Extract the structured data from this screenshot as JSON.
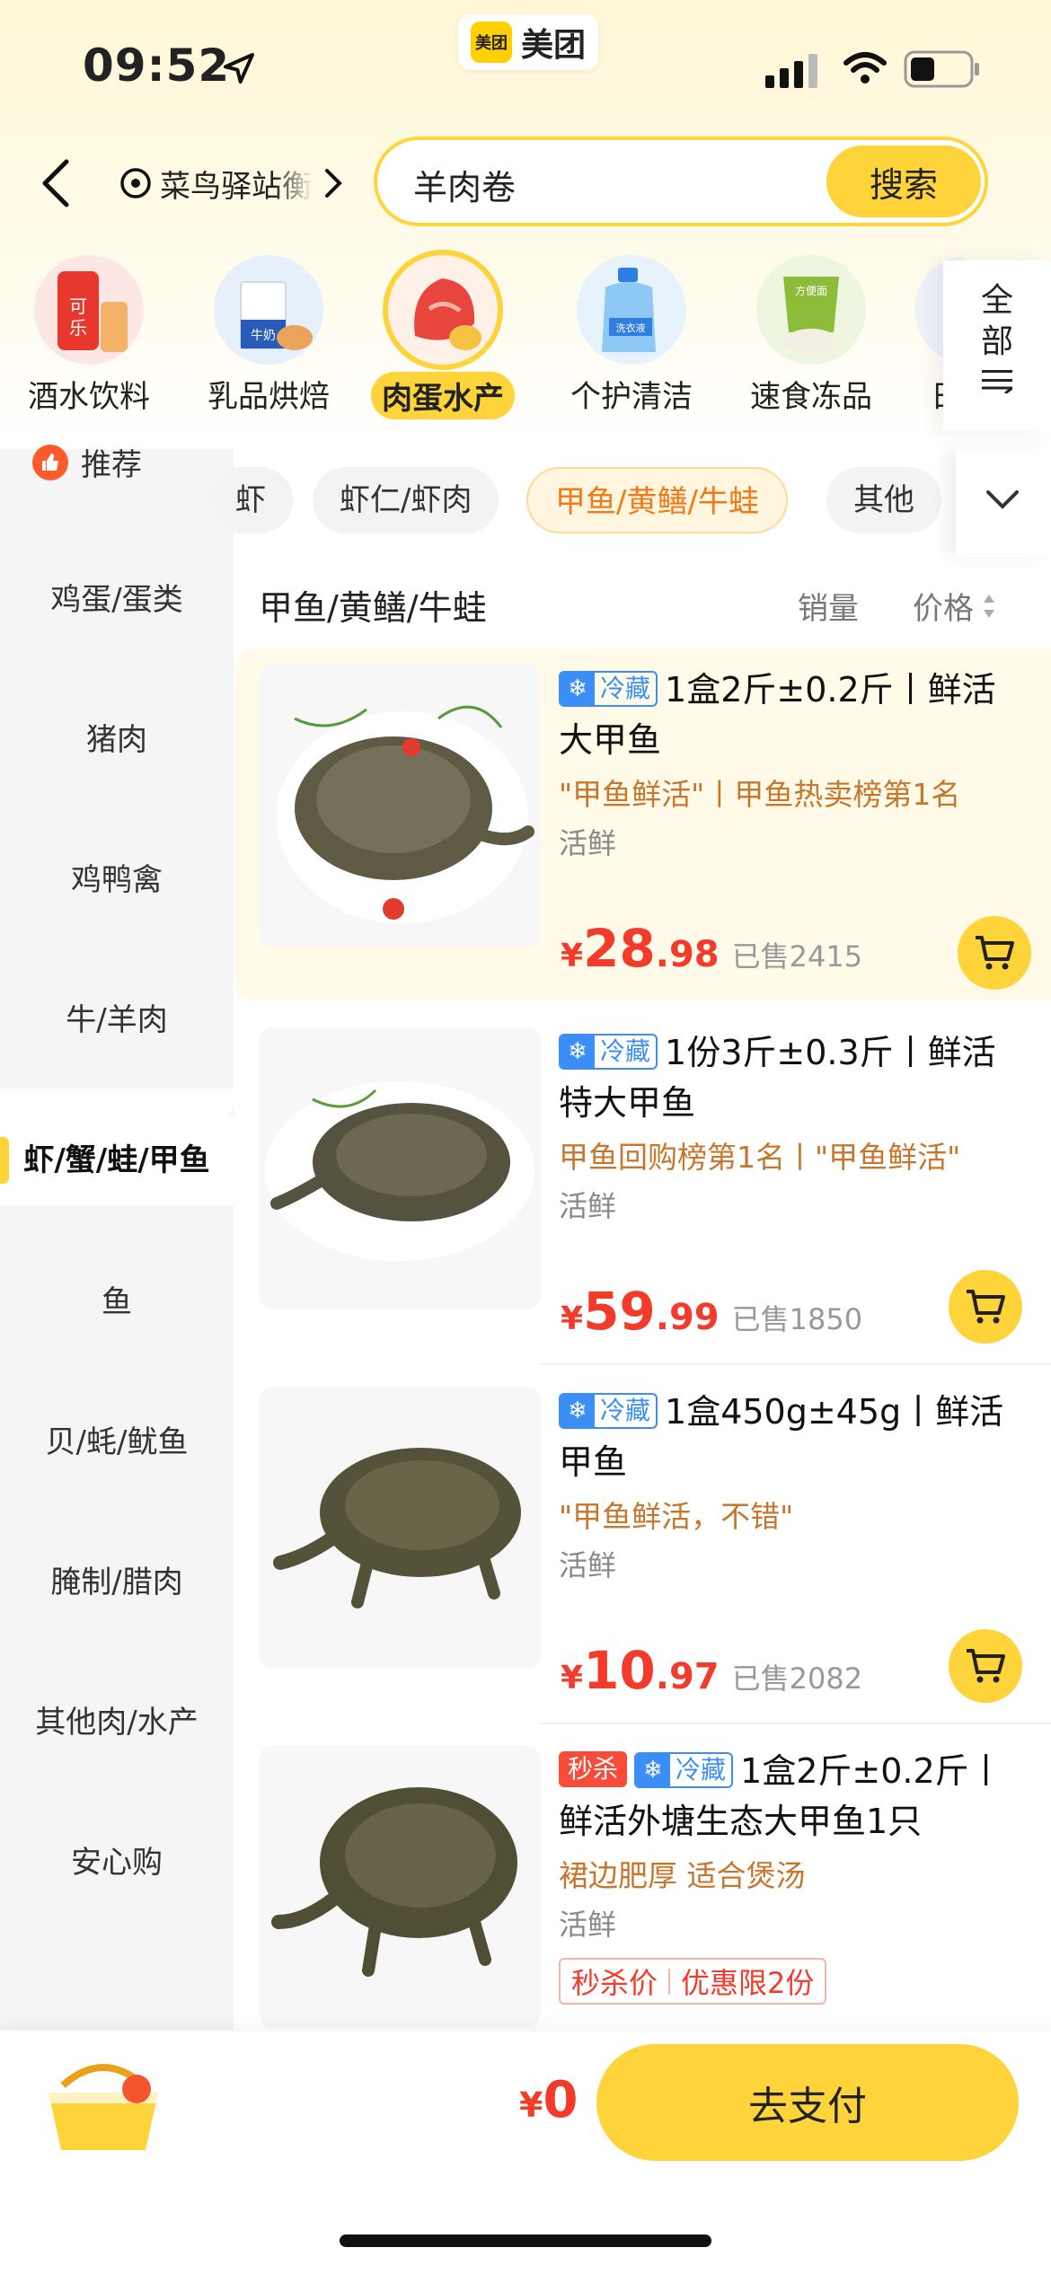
{
  "status_bar": {
    "time": "09:52",
    "app_name": "美团",
    "app_logo_text": "美团"
  },
  "header": {
    "location": "菜鸟驿站衡",
    "search_value": "羊肉卷",
    "search_button": "搜索"
  },
  "categories": [
    {
      "label": "酒水饮料",
      "icon": "drinks-icon"
    },
    {
      "label": "乳品烘焙",
      "icon": "dairy-icon"
    },
    {
      "label": "肉蛋水产",
      "icon": "meat-icon",
      "active": true
    },
    {
      "label": "个护清洁",
      "icon": "detergent-icon"
    },
    {
      "label": "速食冻品",
      "icon": "frozen-food-icon"
    },
    {
      "label": "日",
      "icon": "daily-icon"
    }
  ],
  "category_all": "全部",
  "sidebar": {
    "recommend": "推荐",
    "items": [
      {
        "label": "鸡蛋/蛋类"
      },
      {
        "label": "猪肉"
      },
      {
        "label": "鸡鸭禽"
      },
      {
        "label": "牛/羊肉"
      },
      {
        "label": "虾/蟹/蛙/甲鱼",
        "active": true
      },
      {
        "label": "鱼"
      },
      {
        "label": "贝/蚝/鱿鱼"
      },
      {
        "label": "腌制/腊肉"
      },
      {
        "label": "其他肉/水产"
      },
      {
        "label": "安心购"
      }
    ]
  },
  "subtags": [
    {
      "label": "虾"
    },
    {
      "label": "虾仁/虾肉"
    },
    {
      "label": "甲鱼/黄鳝/牛蛙",
      "active": true
    },
    {
      "label": "其他"
    }
  ],
  "list_header": {
    "title": "甲鱼/黄鳝/牛蛙",
    "sort_sales": "销量",
    "sort_price": "价格"
  },
  "cold_tag": "冷藏",
  "sale_tag": "秒杀",
  "products": [
    {
      "name": "1盒2斤±0.2斤丨鲜活大甲鱼",
      "desc": "\"甲鱼鲜活\"丨甲鱼热卖榜第1名",
      "fresh": "活鲜",
      "price_cur": "¥",
      "price_int": "28",
      "price_dec": ".98",
      "sold": "已售2415"
    },
    {
      "name": "1份3斤±0.3斤丨鲜活特大甲鱼",
      "desc": "甲鱼回购榜第1名丨\"甲鱼鲜活\"",
      "fresh": "活鲜",
      "price_cur": "¥",
      "price_int": "59",
      "price_dec": ".99",
      "sold": "已售1850"
    },
    {
      "name": "1盒450g±45g丨鲜活甲鱼",
      "desc": "\"甲鱼鲜活，不错\"",
      "fresh": "活鲜",
      "price_cur": "¥",
      "price_int": "10",
      "price_dec": ".97",
      "sold": "已售2082"
    },
    {
      "name": "1盒2斤±0.2斤丨鲜活外塘生态大甲鱼1只",
      "desc": "裙边肥厚 适合煲汤",
      "fresh": "活鲜",
      "promo_a": "秒杀价",
      "promo_b": "优惠限2份"
    }
  ],
  "bottom_bar": {
    "total_cur": "¥",
    "total_value": "0",
    "pay_label": "去支付"
  },
  "colors": {
    "accent": "#ffd43b",
    "price": "#f23b2a",
    "cold": "#3a8ef5",
    "tag_orange": "#f07a1a"
  }
}
